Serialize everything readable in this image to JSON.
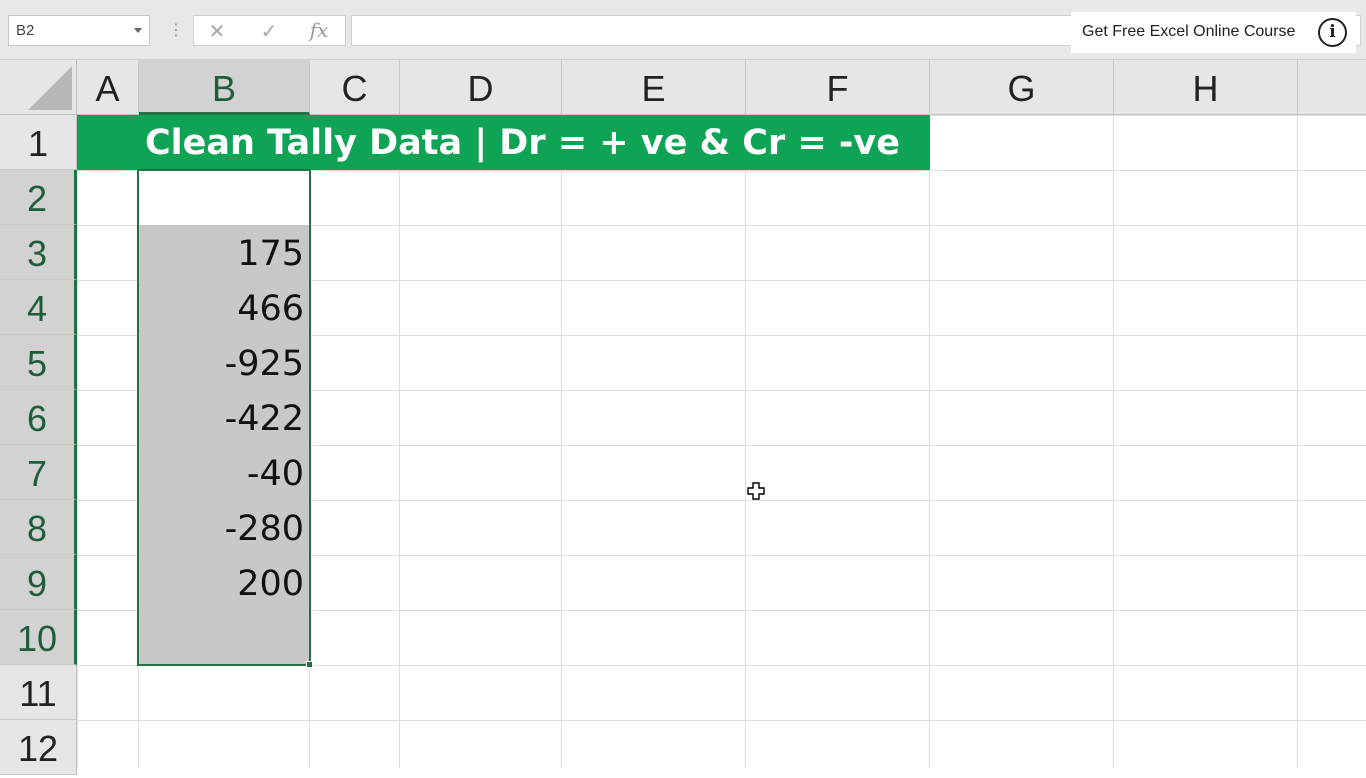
{
  "formula_bar": {
    "name_box": "B2",
    "cancel_glyph": "✕",
    "enter_glyph": "✓",
    "fx_glyph": "fx",
    "formula_value": ""
  },
  "promo": {
    "text": "Get Free Excel Online Course",
    "icon": "info-icon"
  },
  "columns": [
    "A",
    "B",
    "C",
    "D",
    "E",
    "F",
    "G",
    "H"
  ],
  "rows": [
    "1",
    "2",
    "3",
    "4",
    "5",
    "6",
    "7",
    "8",
    "9",
    "10",
    "11",
    "12"
  ],
  "sheet": {
    "title": "Clean Tally Data | Dr = + ve & Cr = -ve",
    "title_color": "#0fa356",
    "selected_column": "B",
    "selected_range": "B2:B10",
    "values": [
      "175",
      "466",
      "-925",
      "-422",
      "-40",
      "-280",
      "200"
    ]
  },
  "colors": {
    "selection_border": "#217346",
    "selection_fill": "#c8c8c8"
  }
}
